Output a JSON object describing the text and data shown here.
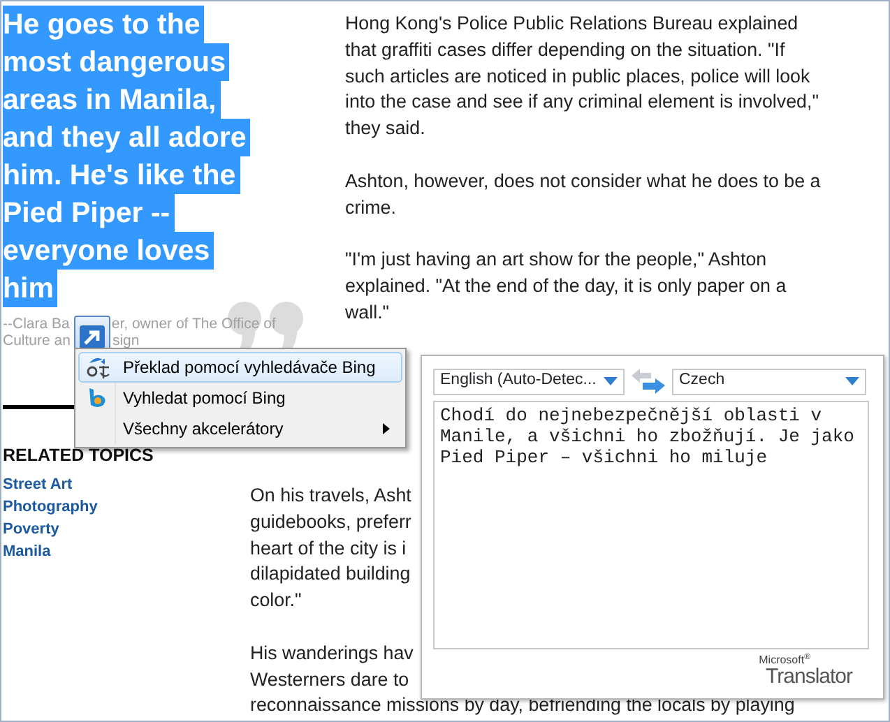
{
  "pull_quote": {
    "lines": [
      "He goes to the",
      "most dangerous",
      "areas in Manila,",
      "and they all adore",
      "him. He's like the",
      "Pied Piper --",
      "everyone loves",
      "him"
    ],
    "selected": true
  },
  "attribution": [
    {
      "before": "--Clara Ba",
      "after": "er, owner of The Office of"
    },
    {
      "before": "Culture an",
      "after": "sign"
    }
  ],
  "related_topics": {
    "heading": "RELATED TOPICS",
    "links": [
      "Street Art",
      "Photography",
      "Poverty",
      "Manila"
    ]
  },
  "article": {
    "upper_paragraphs": [
      [
        "Hong Kong's Police Public Relations Bureau explained",
        "that graffiti cases differ depending on the situation. \"If",
        "such articles are noticed in public places, police will look",
        "into the case and see if any criminal element is involved,\"",
        "they said."
      ],
      [
        "Ashton, however, does not consider what he does to be a",
        "crime."
      ],
      [
        "\"I'm just having an art show for the people,\" Ashton",
        "explained. \"At the end of the day, it is only paper on a",
        "wall.\""
      ]
    ],
    "lower_paragraphs": [
      [
        "On his travels, Asht",
        "guidebooks, preferr",
        "heart of the city is i",
        "dilapidated building",
        "color.\""
      ],
      [
        "His wanderings hav",
        "Westerners dare to",
        "reconnaissance missions by day, befriending the locals by playing"
      ]
    ]
  },
  "context_menu": {
    "items": [
      {
        "kind": "translate",
        "label": "Překlad pomocí vyhledávače Bing",
        "selected": true
      },
      {
        "kind": "search",
        "label": "Vyhledat pomocí Bing",
        "selected": false
      },
      {
        "kind": "submenu",
        "label": "Všechny akcelerátory",
        "selected": false
      }
    ]
  },
  "translator": {
    "source_language": "English (Auto-Detec...",
    "target_language": "Czech",
    "translation": "Chodí do nejnebezpečnější oblasti v Manile, a všichni ho zbožňují. Je jako Pied Piper – všichni ho miluje",
    "brand": "Microsoft$^{®}$",
    "product": "Translator"
  }
}
